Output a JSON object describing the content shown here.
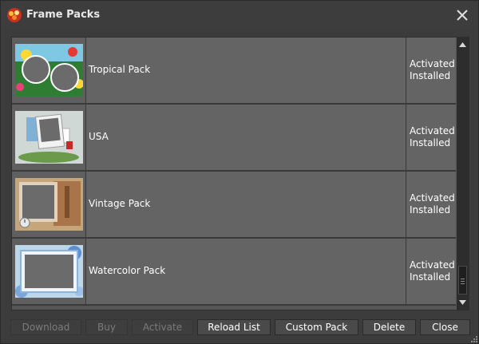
{
  "window": {
    "title": "Frame Packs"
  },
  "packs": [
    {
      "name": "Tropical Pack",
      "status": [
        "Activated",
        "Installed"
      ]
    },
    {
      "name": "USA",
      "status": [
        "Activated",
        "Installed"
      ]
    },
    {
      "name": "Vintage Pack",
      "status": [
        "Activated",
        "Installed"
      ]
    },
    {
      "name": "Watercolor Pack",
      "status": [
        "Activated",
        "Installed"
      ]
    }
  ],
  "buttons": {
    "download": "Download",
    "buy": "Buy",
    "activate": "Activate",
    "reload": "Reload List",
    "custom": "Custom Pack",
    "delete": "Delete",
    "close": "Close"
  },
  "icons": {
    "app": "app-logo-icon",
    "close": "close-x-icon",
    "scroll_up": "triangle-up-icon",
    "scroll_down": "triangle-down-icon"
  },
  "colors": {
    "window_bg": "#3c3c3c",
    "row_bg": "#646464",
    "text": "#ffffff",
    "disabled_text": "#7b7b7b"
  }
}
